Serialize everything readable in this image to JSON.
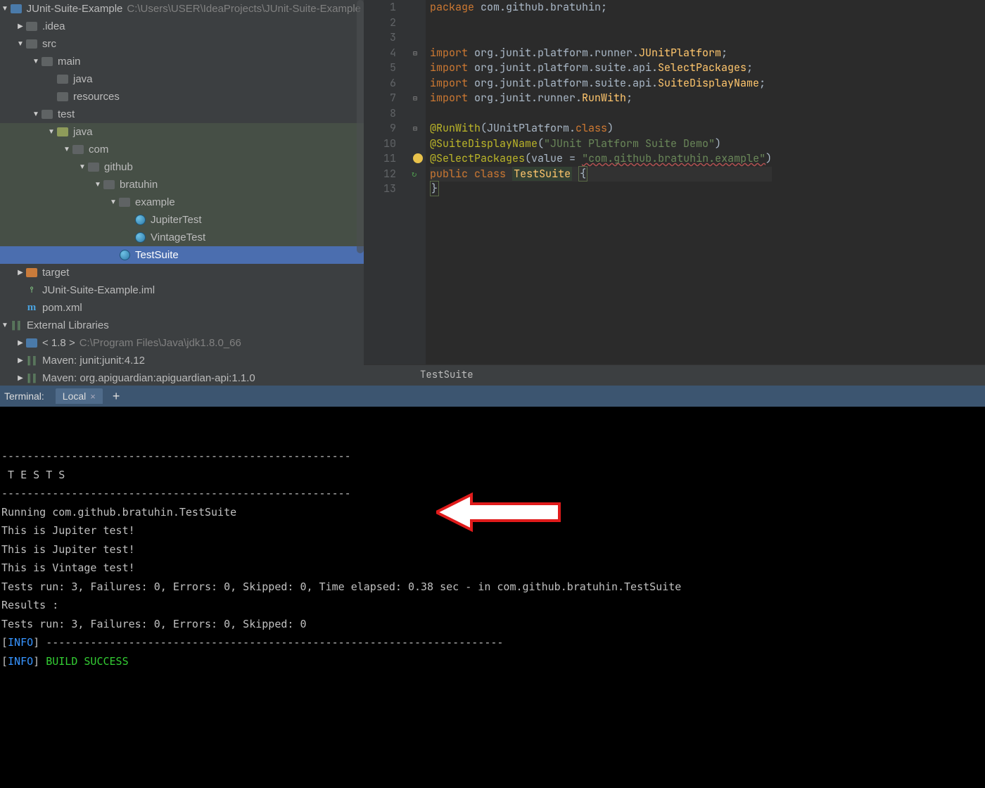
{
  "project": {
    "root": {
      "name": "JUnit-Suite-Example",
      "path": "C:\\Users\\USER\\IdeaProjects\\JUnit-Suite-Example"
    },
    "tree": [
      {
        "level": 0,
        "arrow": "▼",
        "icon": "folder blue",
        "label": "JUnit-Suite-Example",
        "sub": "C:\\Users\\USER\\IdeaProjects\\JUnit-Suite-Example",
        "name": "tree-row-root"
      },
      {
        "level": 1,
        "arrow": "▶",
        "icon": "folder",
        "label": ".idea",
        "name": "tree-row-idea"
      },
      {
        "level": 1,
        "arrow": "▼",
        "icon": "folder",
        "label": "src",
        "name": "tree-row-src"
      },
      {
        "level": 2,
        "arrow": "▼",
        "icon": "folder",
        "label": "main",
        "name": "tree-row-main"
      },
      {
        "level": 3,
        "arrow": "",
        "icon": "folder",
        "label": "java",
        "name": "tree-row-main-java"
      },
      {
        "level": 3,
        "arrow": "",
        "icon": "folder",
        "label": "resources",
        "name": "tree-row-main-res"
      },
      {
        "level": 2,
        "arrow": "▼",
        "icon": "folder",
        "label": "test",
        "name": "tree-row-test"
      },
      {
        "level": 3,
        "arrow": "▼",
        "icon": "folder src",
        "label": "java",
        "green": true,
        "name": "tree-row-test-java"
      },
      {
        "level": 4,
        "arrow": "▼",
        "icon": "folder",
        "label": "com",
        "green": true,
        "name": "tree-row-com"
      },
      {
        "level": 5,
        "arrow": "▼",
        "icon": "folder",
        "label": "github",
        "green": true,
        "name": "tree-row-github"
      },
      {
        "level": 6,
        "arrow": "▼",
        "icon": "folder",
        "label": "bratuhin",
        "green": true,
        "name": "tree-row-bratuhin"
      },
      {
        "level": 7,
        "arrow": "▼",
        "icon": "folder",
        "label": "example",
        "green": true,
        "name": "tree-row-example"
      },
      {
        "level": 8,
        "arrow": "",
        "icon": "class",
        "label": "JupiterTest",
        "green": true,
        "name": "tree-row-jupiter"
      },
      {
        "level": 8,
        "arrow": "",
        "icon": "class",
        "label": "VintageTest",
        "green": true,
        "name": "tree-row-vintage"
      },
      {
        "level": 7,
        "arrow": "",
        "icon": "class",
        "label": "TestSuite",
        "highlighted": true,
        "name": "tree-row-testsuite"
      },
      {
        "level": 1,
        "arrow": "▶",
        "icon": "folder orange",
        "label": "target",
        "name": "tree-row-target"
      },
      {
        "level": 1,
        "arrow": "",
        "icon": "iml",
        "label": "JUnit-Suite-Example.iml",
        "name": "tree-row-iml"
      },
      {
        "level": 1,
        "arrow": "",
        "icon": "pom",
        "label": "pom.xml",
        "name": "tree-row-pom"
      },
      {
        "level": 0,
        "arrow": "▼",
        "icon": "lib",
        "label": "External Libraries",
        "name": "tree-row-extlib"
      },
      {
        "level": 1,
        "arrow": "▶",
        "icon": "folder blue",
        "label": "< 1.8 >",
        "sub": "C:\\Program Files\\Java\\jdk1.8.0_66",
        "name": "tree-row-jdk"
      },
      {
        "level": 1,
        "arrow": "▶",
        "icon": "lib",
        "label": "Maven: junit:junit:4.12",
        "name": "tree-row-mvn-junit"
      },
      {
        "level": 1,
        "arrow": "▶",
        "icon": "lib",
        "label": "Maven: org.apiguardian:apiguardian-api:1.1.0",
        "name": "tree-row-mvn-apig"
      }
    ]
  },
  "editor": {
    "breadcrumb": "TestSuite",
    "lines": [
      {
        "n": 1,
        "tokens": [
          [
            "kw",
            "package"
          ],
          [
            "",
            " "
          ],
          [
            "cls",
            "com.github.bratuhin"
          ],
          [
            "",
            ";"
          ]
        ]
      },
      {
        "n": 2,
        "tokens": []
      },
      {
        "n": 3,
        "tokens": []
      },
      {
        "n": 4,
        "fold": "⊟",
        "tokens": [
          [
            "kw",
            "import"
          ],
          [
            "",
            " "
          ],
          [
            "cls",
            "org.junit.platform.runner."
          ],
          [
            "ident",
            "JUnitPlatform"
          ],
          [
            "",
            ";"
          ]
        ]
      },
      {
        "n": 5,
        "tokens": [
          [
            "kw",
            "import"
          ],
          [
            "",
            " "
          ],
          [
            "cls",
            "org.junit.platform.suite.api."
          ],
          [
            "ident",
            "SelectPackages"
          ],
          [
            "",
            ";"
          ]
        ]
      },
      {
        "n": 6,
        "tokens": [
          [
            "kw",
            "import"
          ],
          [
            "",
            " "
          ],
          [
            "cls",
            "org.junit.platform.suite.api."
          ],
          [
            "ident",
            "SuiteDisplayName"
          ],
          [
            "",
            ";"
          ]
        ]
      },
      {
        "n": 7,
        "fold": "⊟",
        "tokens": [
          [
            "kw",
            "import"
          ],
          [
            "",
            " "
          ],
          [
            "cls",
            "org.junit.runner."
          ],
          [
            "ident",
            "RunWith"
          ],
          [
            "",
            ";"
          ]
        ]
      },
      {
        "n": 8,
        "tokens": []
      },
      {
        "n": 9,
        "fold": "⊟",
        "tokens": [
          [
            "ann",
            "@RunWith"
          ],
          [
            "",
            "("
          ],
          [
            "cls",
            "JUnitPlatform."
          ],
          [
            "kw",
            "class"
          ],
          [
            "",
            ")"
          ]
        ]
      },
      {
        "n": 10,
        "tokens": [
          [
            "ann",
            "@SuiteDisplayName"
          ],
          [
            "",
            "("
          ],
          [
            "str",
            "\"JUnit Platform Suite Demo\""
          ],
          [
            "",
            ")"
          ]
        ]
      },
      {
        "n": 11,
        "bulb": true,
        "tokens": [
          [
            "ann",
            "@SelectPackages"
          ],
          [
            "",
            "("
          ],
          [
            "cls",
            "value"
          ],
          [
            "",
            " = "
          ],
          [
            "strerr",
            "\"com.github.bratuhin.example\""
          ],
          [
            "",
            ")"
          ]
        ]
      },
      {
        "n": 12,
        "run": true,
        "caret": true,
        "tokens": [
          [
            "kw",
            "public"
          ],
          [
            "",
            " "
          ],
          [
            "kw",
            "class"
          ],
          [
            "",
            " "
          ],
          [
            "identbox",
            "TestSuite"
          ],
          [
            "",
            " "
          ],
          [
            "box",
            "{"
          ]
        ]
      },
      {
        "n": 13,
        "tokens": [
          [
            "box",
            "}"
          ]
        ]
      }
    ]
  },
  "terminal": {
    "label": "Terminal:",
    "tab": "Local",
    "lines": [
      "-------------------------------------------------------",
      " T E S T S",
      "-------------------------------------------------------",
      "Running com.github.bratuhin.TestSuite",
      "This is Jupiter test!",
      "This is Jupiter test!",
      "This is Vintage test!",
      "Tests run: 3, Failures: 0, Errors: 0, Skipped: 0, Time elapsed: 0.38 sec - in com.github.bratuhin.TestSuite",
      "",
      "Results :",
      "",
      "Tests run: 3, Failures: 0, Errors: 0, Skipped: 0",
      "",
      "[INFO] ------------------------------------------------------------------------",
      "[INFO] BUILD SUCCESS"
    ]
  }
}
